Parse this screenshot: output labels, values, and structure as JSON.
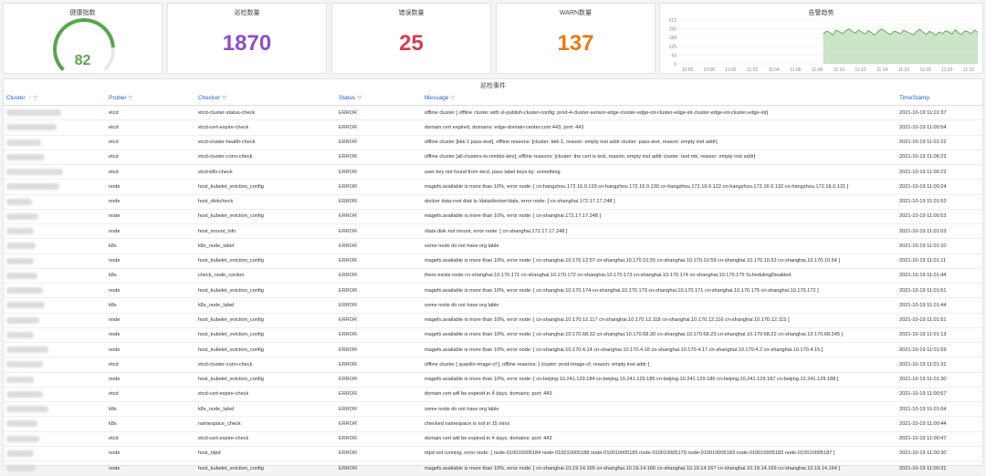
{
  "stats": [
    {
      "title": "健康指数",
      "value": "82"
    },
    {
      "title": "巡检数量",
      "value": "1870",
      "color": "#8f4ec7"
    },
    {
      "title": "错误数量",
      "value": "25",
      "color": "#d63d4f"
    },
    {
      "title": "WARN数量",
      "value": "137",
      "color": "#e77a1a"
    }
  ],
  "trend": {
    "title": "告警趋势",
    "y_ticks": [
      "312",
      "250",
      "188",
      "125",
      "63",
      "0"
    ],
    "x_ticks": [
      "10:55",
      "10:58",
      "11:00",
      "11:02",
      "11:04",
      "11:06",
      "11:08",
      "11:10",
      "11:12",
      "11:14",
      "11:16",
      "11:18",
      "11:20",
      "11:22"
    ],
    "series": [
      0,
      0,
      0,
      0,
      0,
      0,
      0,
      0,
      0,
      0,
      0,
      0,
      0,
      0,
      0,
      0,
      0,
      0,
      0,
      0,
      0,
      0,
      0,
      0,
      0,
      0,
      0,
      0,
      0,
      0,
      0,
      0,
      0,
      0,
      0,
      0,
      0,
      0,
      0,
      0,
      0,
      0,
      0,
      0,
      0,
      210,
      232,
      225,
      205,
      240,
      228,
      215,
      236,
      250,
      230,
      220,
      242,
      226,
      212,
      238,
      222,
      205,
      230,
      248,
      235,
      220,
      210,
      232,
      226,
      214,
      240,
      228,
      218,
      206,
      230,
      246,
      225,
      210,
      232,
      220,
      204,
      228,
      215,
      236,
      226,
      212,
      244,
      220,
      210,
      235,
      228,
      214,
      240,
      225
    ]
  },
  "events": {
    "title": "巡检事件",
    "columns": [
      "Cluster",
      "Prober",
      "Checker",
      "Status",
      "Message",
      "TimeStamp"
    ],
    "rows": [
      {
        "cluster": "",
        "prober": "etcd",
        "checker": "etcd-cluster-status-check",
        "status": "ERROR",
        "message": "offline cluster [ offline cluster with xl-publish-cluster-config: prod-4-cluster-sensor-edge-cluster-edge-iot-cluster-edge-iot-cluster-edge-iot-cluster-edge-iot]",
        "time": "2021-10-19 11:01:37"
      },
      {
        "cluster": "",
        "prober": "etcd",
        "checker": "etcd-cert-expire-check",
        "status": "ERROR",
        "message": "domain cert expired, domains: edge-domain-center.com:443, port: 443",
        "time": "2021-10-19 11:00:54"
      },
      {
        "cluster": "",
        "prober": "etcd",
        "checker": "etcd-cluster-health-check",
        "status": "ERROR",
        "message": "offline cluster [kkk-1 pass-test], offline reasons: [cluster: kkk-1, reason: empty inst addr cluster: pass-test, reason: empty inst addr]",
        "time": "2021-10-19 11:01:22"
      },
      {
        "cluster": "",
        "prober": "etcd",
        "checker": "etcd-cluster-conn-check",
        "status": "ERROR",
        "message": "offline cluster [all-clusters-to-nimble-dev], offline reasons: [cluster: the cert is test, reason: empty inst addr cluster: test mk, reason: empty inst addr]",
        "time": "2021-10-19 11:06:23"
      },
      {
        "cluster": "",
        "prober": "etcd",
        "checker": "etcd-k8s-check",
        "status": "ERROR",
        "message": "user key not found from etcd, pass label keys by: something",
        "time": "2021-10-19 11:00:23"
      },
      {
        "cluster": "",
        "prober": "node",
        "checker": "host_kubelet_eviction_config",
        "status": "ERROR",
        "message": "magefs.available is more than 10%, error node: [ cn-hangzhou.172.16.0.133 cn-hangzhou.172.16.0.130 cn-hangzhou.172.16.0.122 cn-hangzhou.172.16.0.132 cn-hangzhou.172.16.0.131 ]",
        "time": "2021-10-19 11:00:24"
      },
      {
        "cluster": "",
        "prober": "node",
        "checker": "host_diskcheck",
        "status": "ERROR",
        "message": "docker data-root disk is /data/docker/data, error node: [ cn-shanghai.172.17.17.248 ]",
        "time": "2021-10-19 11:01:53"
      },
      {
        "cluster": "",
        "prober": "node",
        "checker": "host_kubelet_eviction_config",
        "status": "ERROR",
        "message": "magefs.available is more than 10%, error node: [ cn-shanghai.172.17.17.248 ]",
        "time": "2021-10-19 11:00:53"
      },
      {
        "cluster": "",
        "prober": "node",
        "checker": "host_mount_info",
        "status": "ERROR",
        "message": "/data disk not mount, error node: [ cn-shanghai.172.17.17.248 ]",
        "time": "2021-10-19 11:01:03"
      },
      {
        "cluster": "",
        "prober": "k8s",
        "checker": "k8s_node_label",
        "status": "ERROR",
        "message": "some node do not have org lable",
        "time": "2021-10-19 11:01:10"
      },
      {
        "cluster": "",
        "prober": "node",
        "checker": "host_kubelet_eviction_config",
        "status": "ERROR",
        "message": "magefs.available is more than 10%, error node: [ cn-shanghai.10.170.12.57 cn-shanghai.10.170.10.55 cn-shanghai.10.170.10.59 cn-shanghai.10.170.10.53 cn-shanghai.10.170.10.54 ]",
        "time": "2021-10-19 11:01:11"
      },
      {
        "cluster": "",
        "prober": "k8s",
        "checker": "check_node_cordon",
        "status": "ERROR",
        "message": "there exists node cn-shanghai.10.170.171 cn-shanghai.10.170.172 cn-shanghai.10.170.173 cn-shanghai.10.170.174 cn-shanghai.10.170.175 SchedulingDisabled",
        "time": "2021-10-19 11:01:44"
      },
      {
        "cluster": "",
        "prober": "node",
        "checker": "host_kubelet_eviction_config",
        "status": "ERROR",
        "message": "magefs.available is more than 10%, error node: [ cn-shanghai.10.170.174 cn-shanghai.10.170.173 cn-shanghai.10.170.171 cn-shanghai.10.170.175 cn-shanghai.10.170.172 ]",
        "time": "2021-10-19 11:01:51"
      },
      {
        "cluster": "",
        "prober": "k8s",
        "checker": "k8s_node_label",
        "status": "ERROR",
        "message": "some node do not have org lable",
        "time": "2021-10-19 11:01:44"
      },
      {
        "cluster": "",
        "prober": "node",
        "checker": "host_kubelet_eviction_config",
        "status": "ERROR",
        "message": "magefs.available is more than 10%, error node: [ cn-shanghai.10.170.12.117 cn-shanghai.10.170.12.118 cn-shanghai.10.170.12.116 cn-shanghai.10.170.12.115 ]",
        "time": "2021-10-19 11:01:51"
      },
      {
        "cluster": "",
        "prober": "node",
        "checker": "host_kubelet_eviction_config",
        "status": "ERROR",
        "message": "magefs.available is more than 10%, error node: [ cn-shanghai.10.170.68.32 cn-shanghai.10.170.68.30 cn-shanghai.10.170.68.23 cn-shanghai.10.170.68.22 cn-shanghai.10.170.68.245 ]",
        "time": "2021-10-19 11:01:13"
      },
      {
        "cluster": "",
        "prober": "node",
        "checker": "host_kubelet_eviction_config",
        "status": "ERROR",
        "message": "magefs.available is more than 10%, error node: [ cn-shanghai.10.170.4.14 cn-shanghai.10.170.4.16 cn-shanghai.10.170.4.17 cn-shanghai.10.170.4.2 cn-shanghai.10.170.4.15 ]",
        "time": "2021-10-19 11:01:59"
      },
      {
        "cluster": "",
        "prober": "etcd",
        "checker": "etcd-cluster-conn-check",
        "status": "ERROR",
        "message": "offline cluster [ quanlin-image-cf ], offline reasons: [ cluster: prod-image-cf, reason: empty inst addr ]",
        "time": "2021-10-19 11:01:31"
      },
      {
        "cluster": "",
        "prober": "node",
        "checker": "host_kubelet_eviction_config",
        "status": "ERROR",
        "message": "magefs.available is more than 10%, error node: [ cn-beijing.10.241.129.184 cn-beijing.10.241.129.185 cn-beijing.10.241.129.186 cn-beijing.10.241.129.187 cn-beijing.10.241.129.188 ]",
        "time": "2021-10-19 11:01:30"
      },
      {
        "cluster": "",
        "prober": "etcd",
        "checker": "etcd-cert-expire-check",
        "status": "ERROR",
        "message": "domain cert will be expired in 4 days, domains: port: 443",
        "time": "2021-10-19 11:00:57"
      },
      {
        "cluster": "",
        "prober": "k8s",
        "checker": "k8s_node_label",
        "status": "ERROR",
        "message": "some node do not have org lable",
        "time": "2021-10-19 11:01:04"
      },
      {
        "cluster": "",
        "prober": "k8s",
        "checker": "namespace_check",
        "status": "ERROR",
        "message": "checked namespace is not in 15 mins",
        "time": "2021-10-19 11:00:44"
      },
      {
        "cluster": "",
        "prober": "etcd",
        "checker": "etcd-cert-expire-check",
        "status": "ERROR",
        "message": "domain cert will be expired in 4 days, domains: port: 443",
        "time": "2021-10-19 11:00:47"
      },
      {
        "cluster": "",
        "prober": "node",
        "checker": "host_ntpd",
        "status": "ERROR",
        "message": "ntpd not running, error node: [ node-010010005184 node-010010005188 node-010010005185 node-010010005179 node-010010005183 node-010010005182 node-010010005187 ]",
        "time": "2021-10-19 11:00:30"
      },
      {
        "cluster": "",
        "prober": "node",
        "checker": "host_kubelet_eviction_config",
        "status": "ERROR",
        "message": "magefs.available is more than 10%, error node: [ cn-shanghai.10.19.14.165 cn-shanghai.10.19.14.166 cn-shanghai.10.19.14.167 cn-shanghai.10.19.14.169 cn-shanghai.10.19.14.164 ]",
        "time": "2021-10-19 11:00:31"
      }
    ]
  },
  "colors": {
    "gauge": "#56a64b",
    "trend_line": "#56a64b",
    "trend_fill": "#b7d9b0",
    "header": "#1f60c4"
  }
}
